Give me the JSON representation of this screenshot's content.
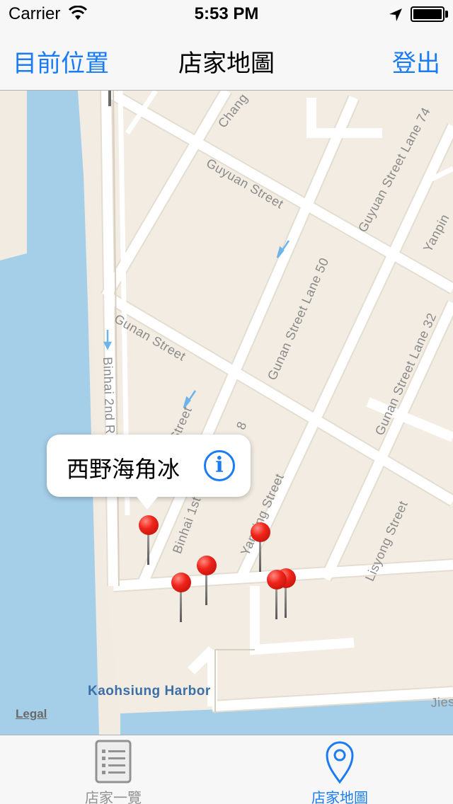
{
  "status_bar": {
    "carrier": "Carrier",
    "time": "5:53 PM",
    "icons": [
      "wifi-icon",
      "location-arrow-icon",
      "battery-icon"
    ]
  },
  "nav_bar": {
    "left_button": "目前位置",
    "title": "店家地圖",
    "right_button": "登出",
    "accent_color": "#1a7cf5"
  },
  "map": {
    "street_labels": [
      "Chang",
      "Guyuan Street",
      "Guyuan Street Lane 74",
      "Yanpin",
      "Gunan Street",
      "Gunan Street Lane 50",
      "Gunan Street Lane 32",
      "Binhai 2nd R",
      "Street",
      "Binhai 1st R",
      "8",
      "Yanping Street",
      "Lisyong Street",
      "Jies"
    ],
    "harbor_label": "Kaohsiung Harbor",
    "legal_label": "Legal",
    "pin_color": "#e8241a",
    "callout": {
      "title": "西野海角冰",
      "info_icon": "i"
    }
  },
  "tab_bar": {
    "tabs": [
      {
        "label": "店家一覽",
        "icon": "list-icon",
        "selected": false
      },
      {
        "label": "店家地圖",
        "icon": "map-pin-icon",
        "selected": true
      }
    ]
  }
}
